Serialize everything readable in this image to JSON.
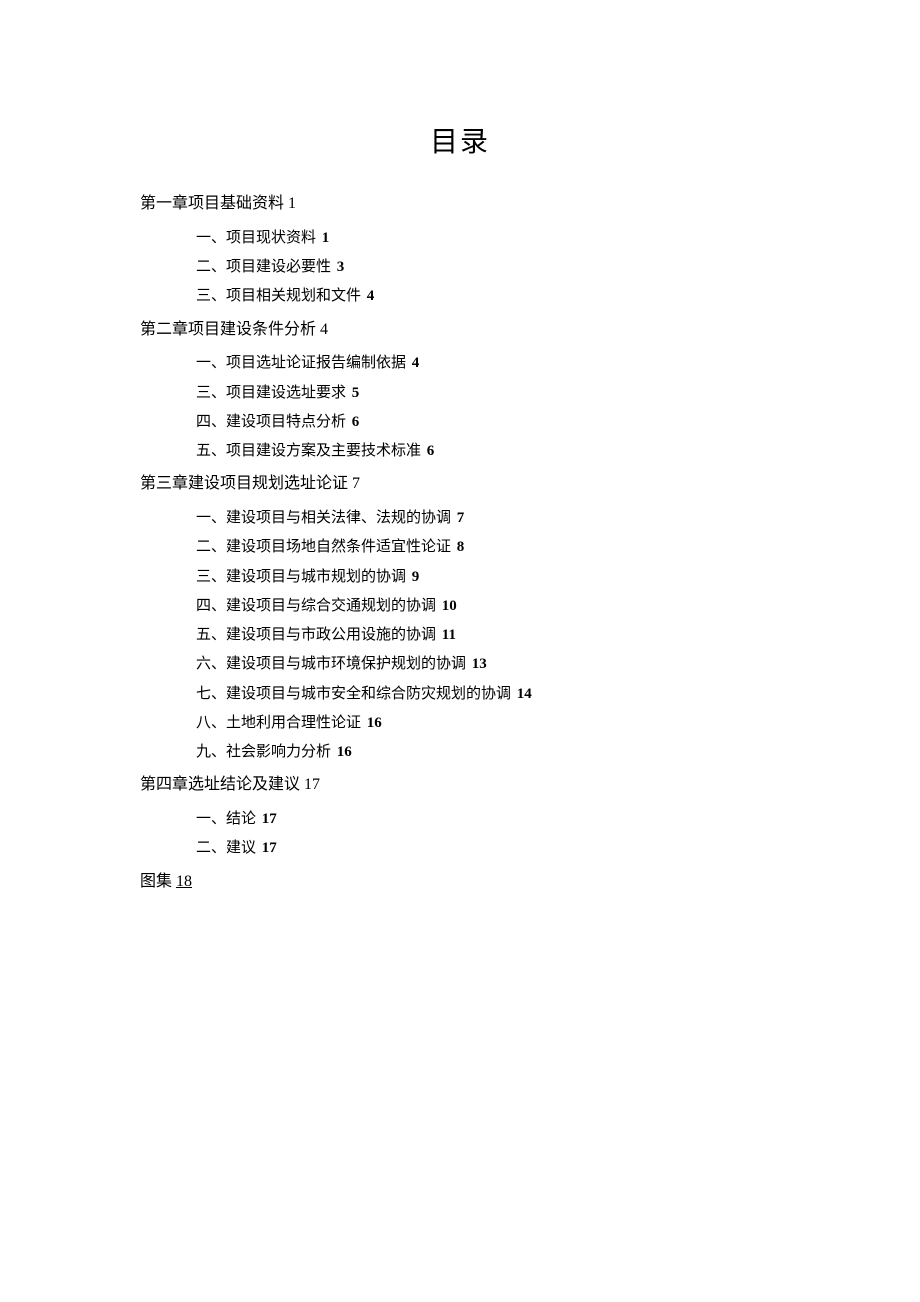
{
  "title": "目录",
  "toc": {
    "chapter1": {
      "heading": "第一章项目基础资料",
      "page": "1",
      "items": [
        {
          "label": "一、项目现状资料",
          "page": "1"
        },
        {
          "label": "二、项目建设必要性",
          "page": "3"
        },
        {
          "label": "三、项目相关规划和文件",
          "page": "4"
        }
      ]
    },
    "chapter2": {
      "heading": "第二章项目建设条件分析",
      "page": "4",
      "items": [
        {
          "label": "一、项目选址论证报告编制依据",
          "page": "4"
        },
        {
          "label": "三、项目建设选址要求",
          "page": "5"
        },
        {
          "label": "四、建设项目特点分析",
          "page": "6"
        },
        {
          "label": "五、项目建设方案及主要技术标准",
          "page": "6"
        }
      ]
    },
    "chapter3": {
      "heading": "第三章建设项目规划选址论证",
      "page": "7",
      "items": [
        {
          "label": "一、建设项目与相关法律、法规的协调",
          "page": "7"
        },
        {
          "label": "二、建设项目场地自然条件适宜性论证",
          "page": "8"
        },
        {
          "label": "三、建设项目与城市规划的协调",
          "page": "9"
        },
        {
          "label": "四、建设项目与综合交通规划的协调",
          "page": "10"
        },
        {
          "label": "五、建设项目与市政公用设施的协调",
          "page": "11"
        },
        {
          "label": "六、建设项目与城市环境保护规划的协调",
          "page": "13"
        },
        {
          "label": "七、建设项目与城市安全和综合防灾规划的协调",
          "page": "14"
        },
        {
          "label": "八、土地利用合理性论证",
          "page": "16"
        },
        {
          "label": "九、社会影响力分析",
          "page": "16"
        }
      ]
    },
    "chapter4": {
      "heading": "第四章选址结论及建议",
      "page": "17",
      "items": [
        {
          "label": "一、结论",
          "page": "17"
        },
        {
          "label": "二、建议",
          "page": "17"
        }
      ]
    },
    "appendix": {
      "heading": "图集",
      "page": "18"
    }
  }
}
